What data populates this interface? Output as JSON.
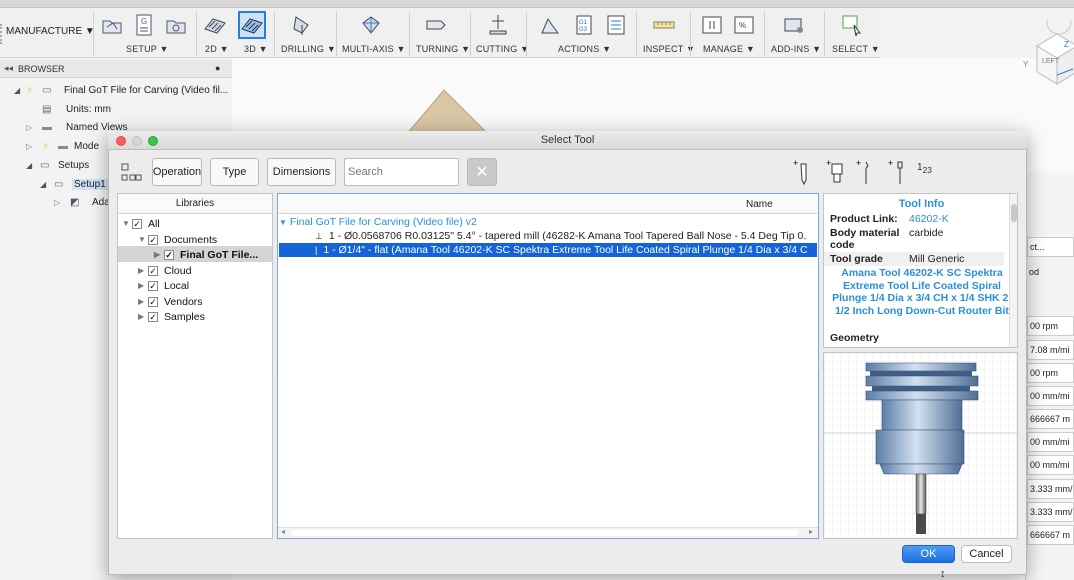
{
  "toolbar": {
    "workspace": "MANUFACTURE",
    "groups": [
      {
        "label": "SETUP",
        "has_menu": true
      },
      {
        "label": "2D",
        "has_menu": true
      },
      {
        "label": "3D",
        "has_menu": true
      },
      {
        "label": "DRILLING",
        "has_menu": true
      },
      {
        "label": "MULTI-AXIS",
        "has_menu": true
      },
      {
        "label": "TURNING",
        "has_menu": true
      },
      {
        "label": "CUTTING",
        "has_menu": true
      },
      {
        "label": "ACTIONS",
        "has_menu": true
      },
      {
        "label": "INSPECT",
        "has_menu": true
      },
      {
        "label": "MANAGE",
        "has_menu": true
      },
      {
        "label": "ADD-INS",
        "has_menu": true
      },
      {
        "label": "SELECT",
        "has_menu": true
      }
    ]
  },
  "viewcube": {
    "left": "LEFT",
    "y": "Y",
    "z": "Z"
  },
  "browser": {
    "title": "BROWSER",
    "items": [
      {
        "label": "Final GoT File for Carving (Video fil...",
        "icon": "document-icon"
      },
      {
        "label": "Units: mm",
        "icon": "units-icon"
      },
      {
        "label": "Named Views",
        "icon": "folder-icon"
      },
      {
        "label": "Mode",
        "icon": "bulb-icon"
      },
      {
        "label": "Setups",
        "icon": "folder-icon"
      },
      {
        "label": "Setup1",
        "icon": "setup-icon"
      },
      {
        "label": "Ada",
        "icon": "operation-icon"
      }
    ]
  },
  "right_panel": {
    "rows": [
      "ct...",
      "od",
      "00 rpm",
      "7.08 m/mi",
      "00 rpm",
      "00 mm/mi",
      "666667 m",
      "00 mm/mi",
      "00 mm/mi",
      "3.333 mm/",
      "3.333 mm/",
      "666667 m"
    ]
  },
  "dialog": {
    "title": "Select Tool",
    "filters": {
      "operation": "Operation",
      "type": "Type",
      "dimensions": "Dimensions",
      "search_placeholder": "Search"
    },
    "libraries": {
      "header": "Libraries",
      "items": [
        {
          "label": "All",
          "checked": true,
          "bold": false
        },
        {
          "label": "Documents",
          "checked": true,
          "bold": false
        },
        {
          "label": "Final GoT File...",
          "checked": true,
          "bold": true,
          "selected": true
        },
        {
          "label": "Cloud",
          "checked": true,
          "bold": false
        },
        {
          "label": "Local",
          "checked": true,
          "bold": false
        },
        {
          "label": "Vendors",
          "checked": true,
          "bold": false
        },
        {
          "label": "Samples",
          "checked": true,
          "bold": false
        }
      ]
    },
    "list": {
      "column": "Name",
      "group": "Final GoT File for Carving (Video file) v2",
      "rows": [
        {
          "text": "1 - Ø0.0568706 R0.03125\" 5.4° - tapered mill (46282-K Amana Tool Tapered Ball Nose - 5.4 Deg Tip 0.",
          "selected": false
        },
        {
          "text": "1 - Ø1/4\" - flat (Amana Tool 46202-K SC Spektra Extreme Tool Life Coated Spiral Plunge 1/4 Dia x 3/4 C",
          "selected": true
        }
      ]
    },
    "info": {
      "header": "Tool Info",
      "product_link_label": "Product Link:",
      "product_link": "46202-K",
      "body_material_label": "Body material code",
      "body_material": "carbide",
      "tool_grade_label": "Tool grade",
      "tool_grade": "Mill Generic",
      "description": "Amana Tool 46202-K SC Spektra Extreme Tool Life Coated Spiral Plunge 1/4 Dia x 3/4 CH x 1/4 SHK 2-1/2 Inch Long Down-Cut Router Bit",
      "section": "Geometry"
    },
    "ok": "OK",
    "cancel": "Cancel"
  },
  "colors": {
    "accent": "#2a7ae2",
    "link": "#2b8fd6",
    "selection": "#1463d8"
  }
}
